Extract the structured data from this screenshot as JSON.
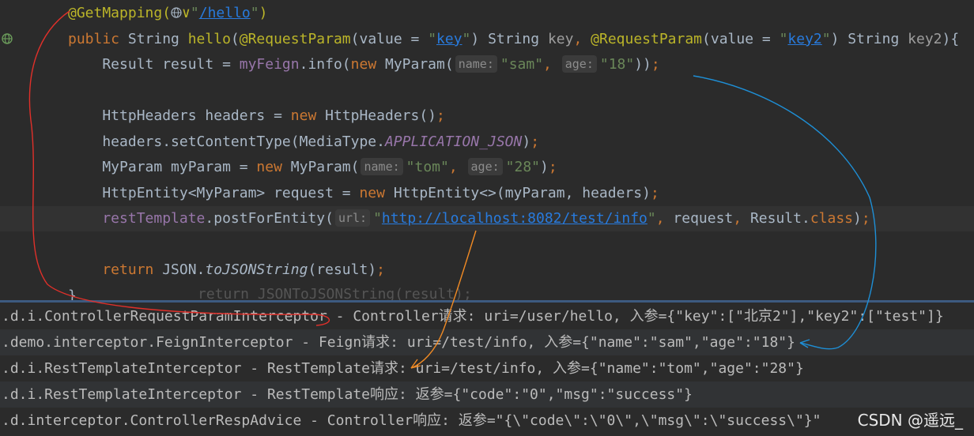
{
  "editor": {
    "lines": [
      {
        "parts": [
          [
            "ann",
            "@GetMapping("
          ],
          [
            "globe",
            ""
          ],
          [
            "ann",
            "∨"
          ],
          [
            "str",
            "\""
          ],
          [
            "url",
            "/hello"
          ],
          [
            "str",
            "\""
          ],
          [
            "ann",
            ")"
          ]
        ]
      },
      {
        "parts": [
          [
            "kw",
            "public "
          ],
          [
            "var",
            "String "
          ],
          [
            "ann2",
            "hello"
          ],
          [
            "var",
            "("
          ],
          [
            "ann",
            "@RequestParam"
          ],
          [
            "var",
            "(value = "
          ],
          [
            "str",
            "\""
          ],
          [
            "url",
            "key"
          ],
          [
            "str",
            "\""
          ],
          [
            "var",
            ") String "
          ],
          [
            "mut",
            "key"
          ],
          [
            "kw",
            ", "
          ],
          [
            "ann",
            "@RequestParam"
          ],
          [
            "var",
            "(value = "
          ],
          [
            "str",
            "\""
          ],
          [
            "url",
            "key2"
          ],
          [
            "str",
            "\""
          ],
          [
            "var",
            ") String "
          ],
          [
            "mut",
            "key2"
          ],
          [
            "var",
            "){"
          ]
        ]
      },
      {
        "parts": [
          [
            "var",
            "    Result result = "
          ],
          [
            "fld",
            "myFeign"
          ],
          [
            "var",
            ".info("
          ],
          [
            "kw",
            "new "
          ],
          [
            "var",
            "MyParam("
          ],
          [
            "hint",
            "name:"
          ],
          [
            "str",
            "\"sam\""
          ],
          [
            "kw",
            ", "
          ],
          [
            "hint",
            "age:"
          ],
          [
            "str",
            "\"18\""
          ],
          [
            "var",
            "))"
          ],
          [
            "kw",
            ";"
          ]
        ]
      },
      {
        "parts": []
      },
      {
        "parts": [
          [
            "var",
            "    HttpHeaders headers = "
          ],
          [
            "kw",
            "new "
          ],
          [
            "var",
            "HttpHeaders()"
          ],
          [
            "kw",
            ";"
          ]
        ]
      },
      {
        "parts": [
          [
            "var",
            "    headers.setContentType(MediaType."
          ],
          [
            "it",
            "APPLICATION_JSON"
          ],
          [
            "var",
            ")"
          ],
          [
            "kw",
            ";"
          ]
        ]
      },
      {
        "parts": [
          [
            "var",
            "    MyParam myParam = "
          ],
          [
            "kw",
            "new "
          ],
          [
            "var",
            "MyParam("
          ],
          [
            "hint",
            "name:"
          ],
          [
            "str",
            "\"tom\""
          ],
          [
            "kw",
            ", "
          ],
          [
            "hint",
            "age:"
          ],
          [
            "str",
            "\"28\""
          ],
          [
            "var",
            ")"
          ],
          [
            "kw",
            ";"
          ]
        ]
      },
      {
        "parts": [
          [
            "var",
            "    HttpEntity<MyParam> request = "
          ],
          [
            "kw",
            "new "
          ],
          [
            "var",
            "HttpEntity<>(myParam, headers)"
          ],
          [
            "kw",
            ";"
          ]
        ]
      },
      {
        "parts": [
          [
            "fld",
            "    restTemplate"
          ],
          [
            "var",
            ".postForEntity("
          ],
          [
            "hint",
            "url:"
          ],
          [
            "str",
            "\""
          ],
          [
            "url",
            "http://localhost:8082/test/info"
          ],
          [
            "str",
            "\""
          ],
          [
            "kw",
            ", "
          ],
          [
            "var",
            "request"
          ],
          [
            "kw",
            ", "
          ],
          [
            "var",
            "Result."
          ],
          [
            "kw",
            "class"
          ],
          [
            "var",
            ")"
          ],
          [
            "kw",
            ";"
          ]
        ]
      },
      {
        "parts": []
      },
      {
        "parts": [
          [
            "kw",
            "    return "
          ],
          [
            "var",
            "JSON."
          ],
          [
            "static",
            "toJSONString"
          ],
          [
            "var",
            "(result)"
          ],
          [
            "kw",
            ";"
          ]
        ]
      },
      {
        "parts": [
          [
            "var",
            "}"
          ]
        ]
      }
    ],
    "ghost_text": "return JSONToJSONString(result);"
  },
  "console": {
    "lines": [
      ".d.i.ControllerRequestParamInterceptor - Controller请求: uri=/user/hello, 入参={\"key\":[\"北京2\"],\"key2\":[\"test\"]}",
      ".demo.interceptor.FeignInterceptor - Feign请求: uri=/test/info, 入参={\"name\":\"sam\",\"age\":\"18\"}",
      ".d.i.RestTemplateInterceptor - RestTemplate请求: uri=/test/info, 入参={\"name\":\"tom\",\"age\":\"28\"}",
      ".d.i.RestTemplateInterceptor - RestTemplate响应: 返参={\"code\":\"0\",\"msg\":\"success\"}",
      ".d.interceptor.ControllerRespAdvice - Controller响应: 返参=\"{\\\"code\\\":\\\"0\\\",\\\"msg\\\":\\\"success\\\"}\""
    ]
  },
  "watermark": "CSDN @遥远_",
  "colors": {
    "red_arrow": "#e0302a",
    "blue_arrow": "#1e8fd6",
    "orange_arrow": "#f08a24"
  }
}
